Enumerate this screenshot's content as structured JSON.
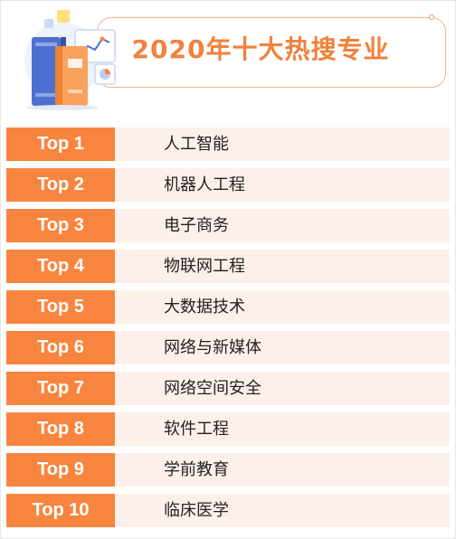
{
  "header": {
    "title": "2020年十大热搜专业",
    "illustration_icon": "books-and-charts-icon"
  },
  "colors": {
    "accent": "#f8853f",
    "title": "#f0823d",
    "row_background": "#fdf0ea",
    "frame": "#f6b08a"
  },
  "rankings": [
    {
      "rank": "Top 1",
      "major": "人工智能"
    },
    {
      "rank": "Top 2",
      "major": "机器人工程"
    },
    {
      "rank": "Top 3",
      "major": "电子商务"
    },
    {
      "rank": "Top 4",
      "major": "物联网工程"
    },
    {
      "rank": "Top 5",
      "major": "大数据技术"
    },
    {
      "rank": "Top 6",
      "major": "网络与新媒体"
    },
    {
      "rank": "Top 7",
      "major": "网络空间安全"
    },
    {
      "rank": "Top 8",
      "major": "软件工程"
    },
    {
      "rank": "Top 9",
      "major": "学前教育"
    },
    {
      "rank": "Top 10",
      "major": "临床医学"
    }
  ]
}
